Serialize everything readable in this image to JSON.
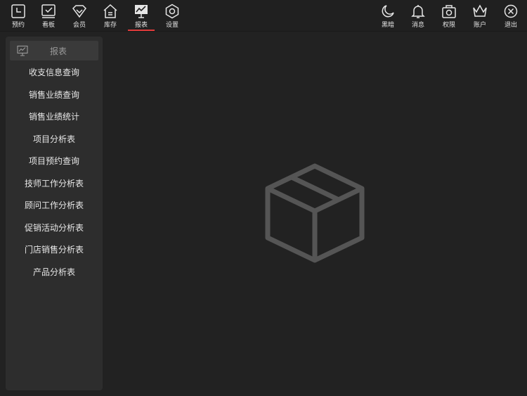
{
  "nav_left": [
    {
      "label": "预约",
      "icon": "clock-icon"
    },
    {
      "label": "看板",
      "icon": "checkbox-icon"
    },
    {
      "label": "会员",
      "icon": "diamond-icon"
    },
    {
      "label": "库存",
      "icon": "house-icon"
    },
    {
      "label": "报表",
      "icon": "chart-board-icon",
      "active": true
    },
    {
      "label": "设置",
      "icon": "hexagon-icon"
    }
  ],
  "nav_right": [
    {
      "label": "黑暗",
      "icon": "moon-icon"
    },
    {
      "label": "消息",
      "icon": "bell-icon"
    },
    {
      "label": "权限",
      "icon": "camera-icon"
    },
    {
      "label": "账户",
      "icon": "crown-icon"
    },
    {
      "label": "退出",
      "icon": "close-circle-icon"
    }
  ],
  "sidebar": {
    "title": "报表",
    "items": [
      "收支信息查询",
      "销售业绩查询",
      "销售业绩统计",
      "项目分析表",
      "项目预约查询",
      "技师工作分析表",
      "顾问工作分析表",
      "促销活动分析表",
      "门店销售分析表",
      "产品分析表"
    ]
  },
  "colors": {
    "background": "#222222",
    "sidebar": "#2d2d2d",
    "accent": "#e23b3b",
    "empty_icon": "#555555"
  }
}
